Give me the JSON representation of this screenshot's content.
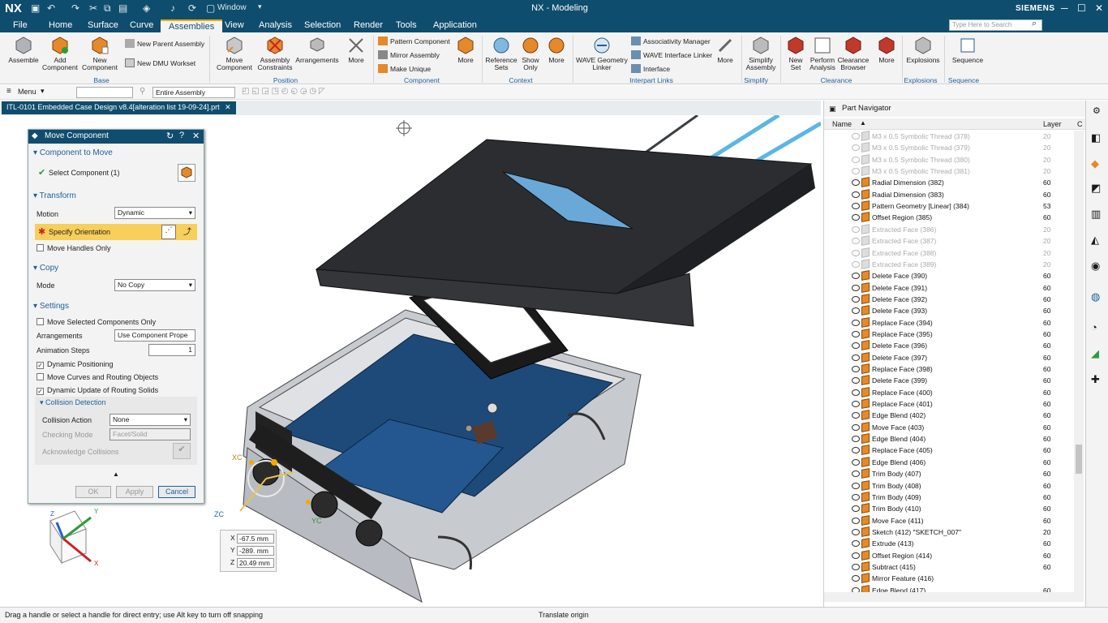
{
  "app": {
    "logo": "NX",
    "window_menu": "Window",
    "title": "NX - Modeling",
    "brand": "SIEMENS"
  },
  "menu": {
    "tabs": [
      "File",
      "Home",
      "Surface",
      "Curve",
      "Assemblies",
      "View",
      "Analysis",
      "Selection",
      "Render",
      "Tools",
      "Application"
    ],
    "active": "Assemblies"
  },
  "search": {
    "placeholder": "Type Here to Search"
  },
  "ribbon": {
    "assemble": "Assemble",
    "add_component": "Add Component",
    "new_component": "New Component",
    "new_parent_assembly": "New Parent Assembly",
    "new_dmu_workset": "New DMU Workset",
    "base_label": "Base",
    "move_component": "Move Component",
    "assembly_constraints": "Assembly Constraints",
    "arrangements": "Arrangements",
    "more": "More",
    "position_label": "Position",
    "pattern_component": "Pattern Component",
    "mirror_assembly": "Mirror Assembly",
    "make_unique": "Make Unique",
    "component_label": "Component",
    "reference_sets": "Reference Sets",
    "show_only": "Show Only",
    "context_label": "Context",
    "wave_geometry_linker": "WAVE Geometry Linker",
    "associativity_manager": "Associativity Manager",
    "wave_interface_linker": "WAVE Interface Linker",
    "interface": "Interface",
    "interpart_links_label": "Interpart Links",
    "simplify_assembly": "Simplify Assembly",
    "simplify_label": "Simplify",
    "new_set": "New Set",
    "perform_analysis": "Perform Analysis",
    "clearance_browser": "Clearance Browser",
    "clearance_label": "Clearance",
    "explosions": "Explosions",
    "sequence": "Sequence"
  },
  "toolbar2": {
    "menu": "Menu",
    "filter": "Entire Assembly"
  },
  "doc_tab": "ITL-0101 Embedded Case Design v8.4[alteration list 19-09-24].prt",
  "dialog": {
    "title": "Move Component",
    "sec_component": "Component to Move",
    "select_component": "Select Component (1)",
    "sec_transform": "Transform",
    "motion_label": "Motion",
    "motion_value": "Dynamic",
    "specify_orientation": "Specify Orientation",
    "move_handles_only": "Move Handles Only",
    "sec_copy": "Copy",
    "mode_label": "Mode",
    "mode_value": "No Copy",
    "sec_settings": "Settings",
    "move_selected_only": "Move Selected Components Only",
    "arrangements_label": "Arrangements",
    "arrangements_value": "Use Component Prope",
    "animation_steps_label": "Animation Steps",
    "animation_steps_value": "1",
    "dynamic_positioning": "Dynamic Positioning",
    "move_curves": "Move Curves and Routing Objects",
    "dynamic_update": "Dynamic Update of Routing Solids",
    "sec_collision": "Collision Detection",
    "collision_action_label": "Collision Action",
    "collision_action_value": "None",
    "checking_mode_label": "Checking Mode",
    "checking_mode_value": "Facet/Solid",
    "acknowledge": "Acknowledge Collisions",
    "ok": "OK",
    "apply": "Apply",
    "cancel": "Cancel"
  },
  "viewport": {
    "xc": "XC",
    "yc": "YC",
    "zc": "ZC",
    "axis_x": "X",
    "axis_y": "Y",
    "axis_z": "Z",
    "coords": {
      "x": "-67.5 mm",
      "y": "-289. mm",
      "z": "20.49 mm"
    }
  },
  "navigator": {
    "title": "Part Navigator",
    "col_name": "Name",
    "col_layer": "Layer",
    "col_c": "C",
    "rows": [
      {
        "name": "M3 x 0.5 Symbolic Thread (378)",
        "layer": "20",
        "grey": true
      },
      {
        "name": "M3 x 0.5 Symbolic Thread (379)",
        "layer": "20",
        "grey": true
      },
      {
        "name": "M3 x 0.5 Symbolic Thread (380)",
        "layer": "20",
        "grey": true
      },
      {
        "name": "M3 x 0.5 Symbolic Thread (381)",
        "layer": "20",
        "grey": true
      },
      {
        "name": "Radial Dimension (382)",
        "layer": "60",
        "grey": false
      },
      {
        "name": "Radial Dimension (383)",
        "layer": "60",
        "grey": false
      },
      {
        "name": "Pattern Geometry [Linear] (384)",
        "layer": "53",
        "grey": false
      },
      {
        "name": "Offset Region (385)",
        "layer": "60",
        "grey": false
      },
      {
        "name": "Extracted Face (386)",
        "layer": "20",
        "grey": true
      },
      {
        "name": "Extracted Face (387)",
        "layer": "20",
        "grey": true
      },
      {
        "name": "Extracted Face (388)",
        "layer": "20",
        "grey": true
      },
      {
        "name": "Extracted Face (389)",
        "layer": "20",
        "grey": true
      },
      {
        "name": "Delete Face (390)",
        "layer": "60",
        "grey": false
      },
      {
        "name": "Delete Face (391)",
        "layer": "60",
        "grey": false
      },
      {
        "name": "Delete Face (392)",
        "layer": "60",
        "grey": false
      },
      {
        "name": "Delete Face (393)",
        "layer": "60",
        "grey": false
      },
      {
        "name": "Replace Face (394)",
        "layer": "60",
        "grey": false
      },
      {
        "name": "Replace Face (395)",
        "layer": "60",
        "grey": false
      },
      {
        "name": "Delete Face (396)",
        "layer": "60",
        "grey": false
      },
      {
        "name": "Delete Face (397)",
        "layer": "60",
        "grey": false
      },
      {
        "name": "Replace Face (398)",
        "layer": "60",
        "grey": false
      },
      {
        "name": "Delete Face (399)",
        "layer": "60",
        "grey": false
      },
      {
        "name": "Replace Face (400)",
        "layer": "60",
        "grey": false
      },
      {
        "name": "Replace Face (401)",
        "layer": "60",
        "grey": false
      },
      {
        "name": "Edge Blend (402)",
        "layer": "60",
        "grey": false
      },
      {
        "name": "Move Face (403)",
        "layer": "60",
        "grey": false
      },
      {
        "name": "Edge Blend (404)",
        "layer": "60",
        "grey": false
      },
      {
        "name": "Replace Face (405)",
        "layer": "60",
        "grey": false
      },
      {
        "name": "Edge Blend (406)",
        "layer": "60",
        "grey": false
      },
      {
        "name": "Trim Body (407)",
        "layer": "60",
        "grey": false
      },
      {
        "name": "Trim Body (408)",
        "layer": "60",
        "grey": false
      },
      {
        "name": "Trim Body (409)",
        "layer": "60",
        "grey": false
      },
      {
        "name": "Trim Body (410)",
        "layer": "60",
        "grey": false
      },
      {
        "name": "Move Face (411)",
        "layer": "60",
        "grey": false
      },
      {
        "name": "Sketch (412) \"SKETCH_007\"",
        "layer": "20",
        "grey": false
      },
      {
        "name": "Extrude (413)",
        "layer": "60",
        "grey": false
      },
      {
        "name": "Offset Region (414)",
        "layer": "60",
        "grey": false
      },
      {
        "name": "Subtract (415)",
        "layer": "60",
        "grey": false
      },
      {
        "name": "Mirror Feature (416)",
        "layer": "",
        "grey": false
      },
      {
        "name": "Edge Blend (417)",
        "layer": "60",
        "grey": false
      }
    ]
  },
  "status": {
    "left": "Drag a handle or select a handle for direct entry; use Alt key to turn off snapping",
    "center": "Translate origin"
  },
  "colors": {
    "titlebar": "#0f4d6e",
    "accent": "#f5a800",
    "pcb": "#1e4a7a",
    "lid": "#2b2d30"
  }
}
